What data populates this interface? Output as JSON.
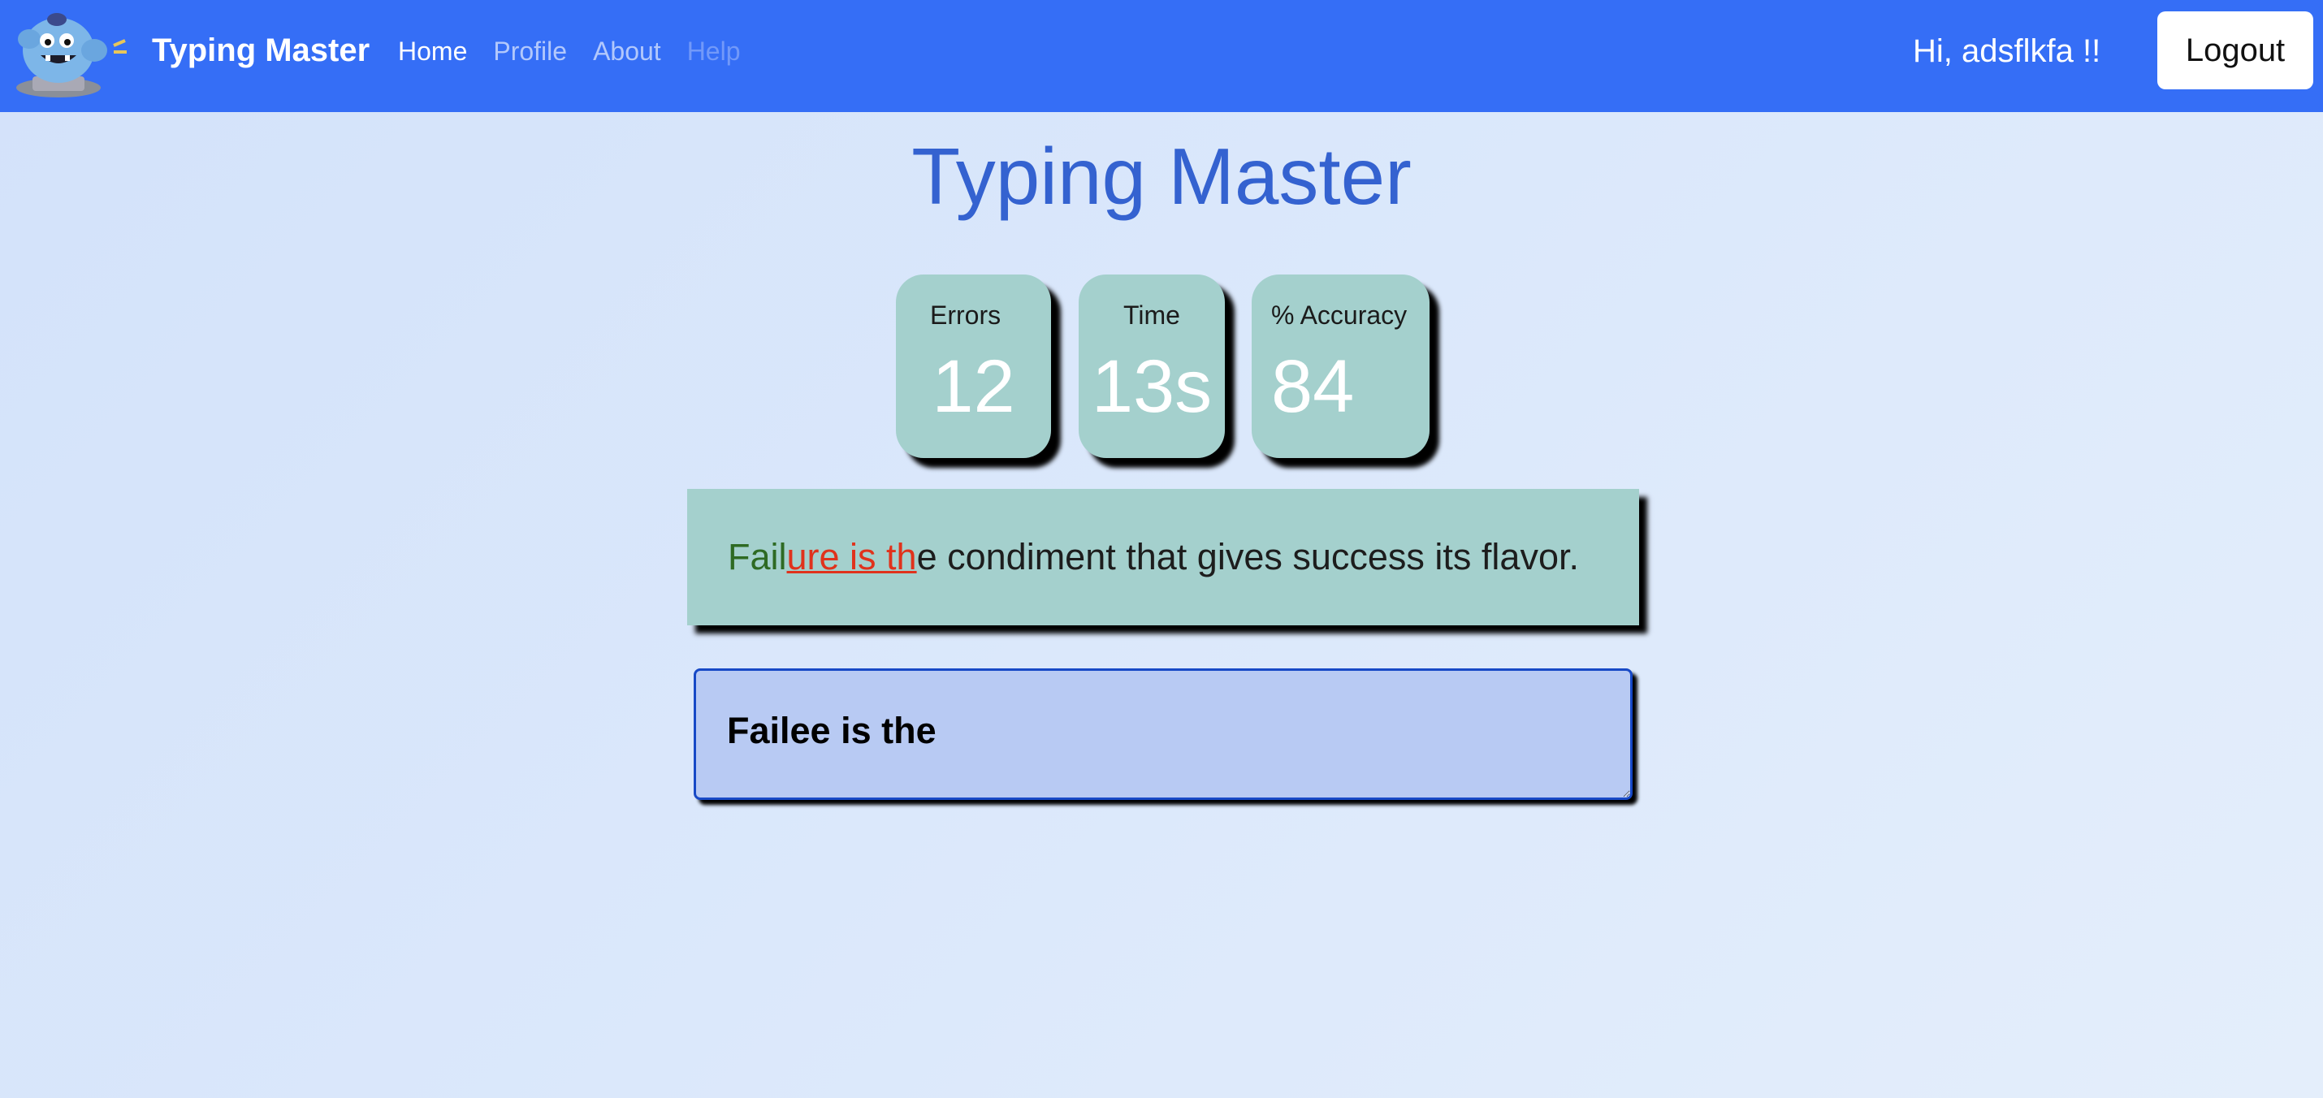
{
  "navbar": {
    "brand": "Typing Master",
    "links": [
      {
        "label": "Home"
      },
      {
        "label": "Profile"
      },
      {
        "label": "About"
      },
      {
        "label": "Help"
      }
    ],
    "greeting": "Hi, adsflkfa !!",
    "logout_label": "Logout",
    "logo_icon": "mascot-monster-icon"
  },
  "title": "Typing Master",
  "stats": {
    "errors": {
      "label": "Errors",
      "value": "12"
    },
    "time": {
      "label": "Time",
      "value": "13s"
    },
    "accuracy": {
      "label": "% Accuracy",
      "value": "84"
    }
  },
  "quote": {
    "correct": "Fail",
    "wrong": "ure is th",
    "remaining": "e condiment that gives success its flavor."
  },
  "input": {
    "value": "Failee is the"
  },
  "colors": {
    "navbar": "#356ef6",
    "title": "#3462d0",
    "card": "#a4d0cd",
    "correct": "#2e6a23",
    "wrong": "#e0321c",
    "input_bg": "#b8caf3"
  }
}
